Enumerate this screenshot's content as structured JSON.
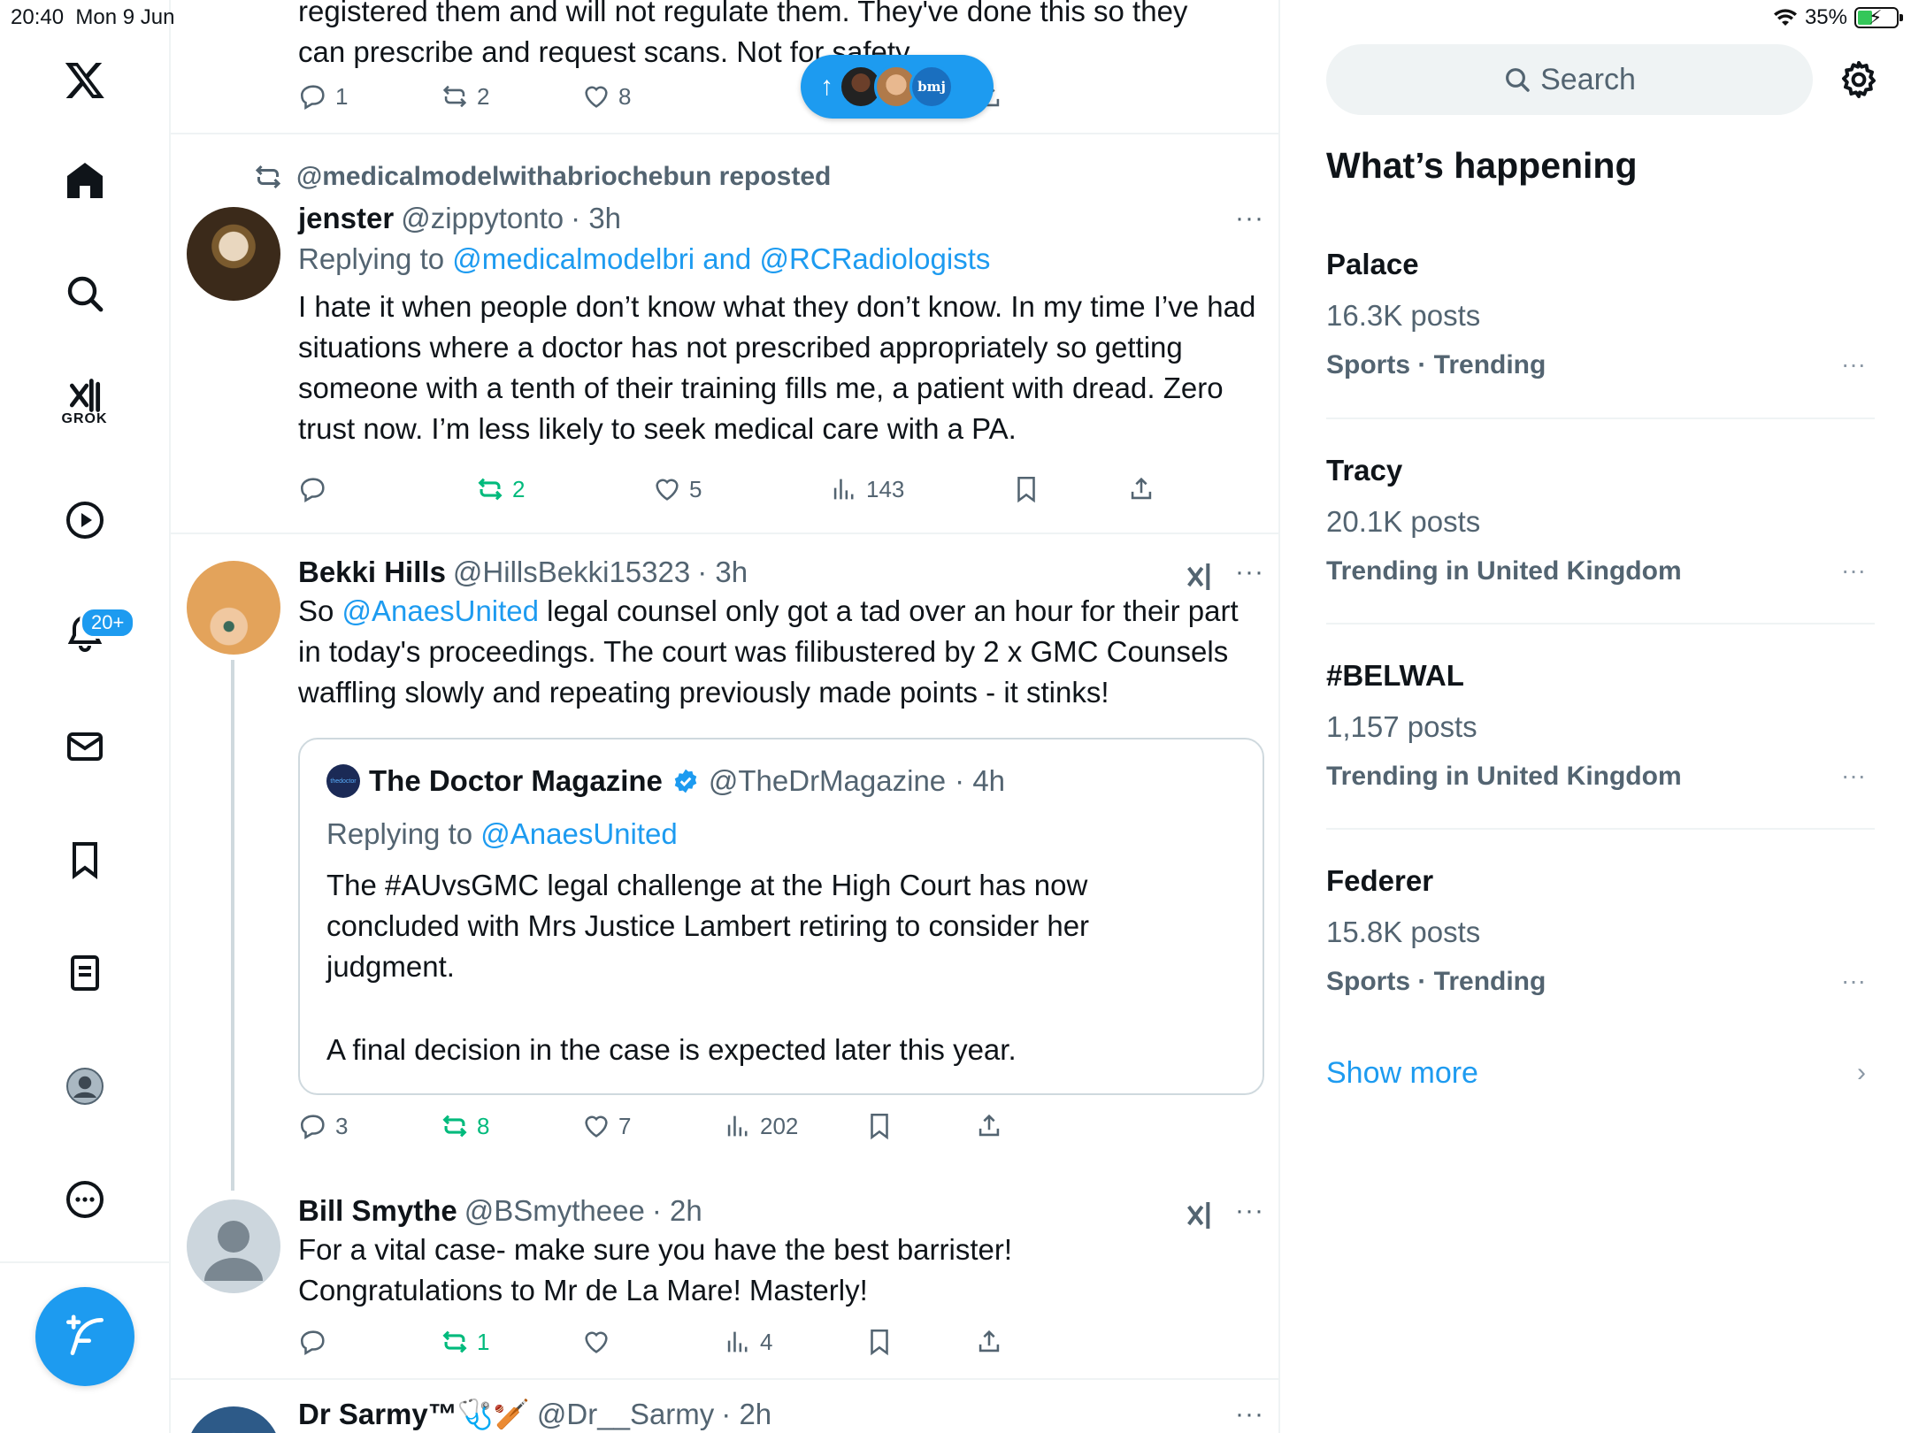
{
  "status_bar": {
    "time": "20:40",
    "date": "Mon 9 Jun",
    "battery": "35%"
  },
  "nav": {
    "grok_label": "GROK",
    "notifications_badge": "20+"
  },
  "new_posts_pill": {
    "arrow": "↑",
    "bmj": "bmj"
  },
  "tweets": [
    {
      "text_line1": "registered them and will not regulate them. They've done this so they",
      "text_line2": "can prescribe and request scans. Not for safety",
      "replies": "1",
      "reposts": "2",
      "likes": "8"
    },
    {
      "reposted_by": "@medicalmodelwithabriochebun reposted",
      "name": "jenster",
      "handle": "@zippytonto",
      "time": "· 3h",
      "replying_prefix": "Replying to",
      "replying_to": "@medicalmodelbri and @RCRadiologists",
      "text": "I hate it when people don’t know what they don’t know. In my time I’ve had situations where a doctor has not prescribed appropriately so getting someone with a tenth of their training fills me, a patient with dread. Zero trust now. I’m less likely to seek medical care with a PA.",
      "reposts": "2",
      "likes": "5",
      "views": "143"
    },
    {
      "name": "Bekki Hills",
      "handle": "@HillsBekki15323",
      "time": "· 3h",
      "text_prefix": "So ",
      "text_mention": "@AnaesUnited",
      "text_rest": " legal counsel only got a tad over an hour for their part in today's proceedings. The court was filibustered by 2 x GMC Counsels waffling slowly and repeating previously made points - it stinks!",
      "quote": {
        "logo": "thedoctor",
        "name": "The Doctor Magazine",
        "handle": "@TheDrMagazine",
        "time": "· 4h",
        "replying_prefix": "Replying to",
        "replying_to": "@AnaesUnited",
        "text1": "The #AUvsGMC legal challenge at the High Court has now concluded with Mrs Justice Lambert retiring to consider her judgment.",
        "text2": "A final decision in the case is expected later this year."
      },
      "replies": "3",
      "reposts": "8",
      "likes": "7",
      "views": "202"
    },
    {
      "name": "Bill Smythe",
      "handle": "@BSmytheee",
      "time": "· 2h",
      "text": "For a vital case- make sure you have the best barrister! Congratulations to Mr de La Mare! Masterly!",
      "reposts": "1",
      "views": "4"
    },
    {
      "name": "Dr Sarmy™🩺🏏",
      "handle": "@Dr__Sarmy",
      "time": "· 2h"
    }
  ],
  "sidebar": {
    "search_placeholder": "Search",
    "title": "What’s happening",
    "trends": [
      {
        "name": "Palace",
        "posts": "16.3K posts",
        "category": "Sports · Trending"
      },
      {
        "name": "Tracy",
        "posts": "20.1K posts",
        "category": "Trending in United Kingdom"
      },
      {
        "name": "#BELWAL",
        "posts": "1,157 posts",
        "category": "Trending in United Kingdom"
      },
      {
        "name": "Federer",
        "posts": "15.8K posts",
        "category": "Sports · Trending"
      }
    ],
    "show_more": "Show more"
  },
  "colors": {
    "accent": "#1d9bf0",
    "repost_green": "#00ba7c",
    "muted": "#536471"
  }
}
